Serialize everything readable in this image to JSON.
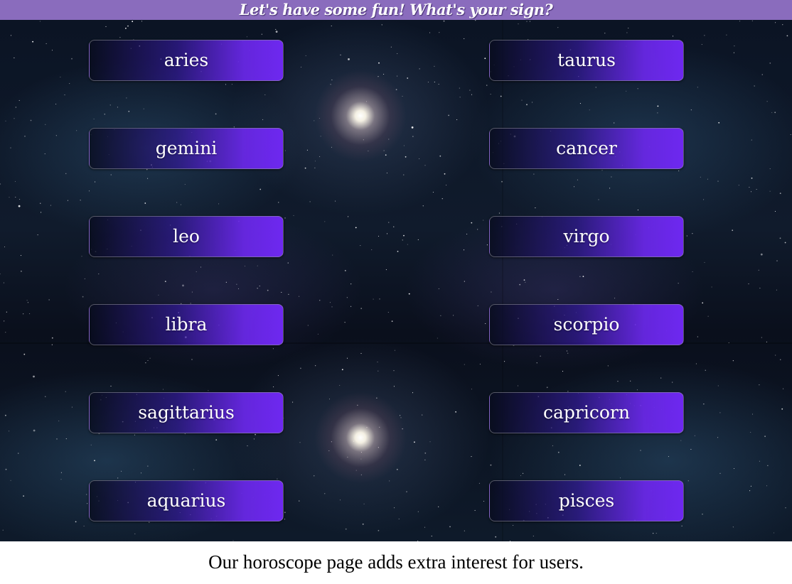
{
  "header": {
    "title": "Let's have some fun! What's your sign?"
  },
  "signs": {
    "left": [
      {
        "label": "aries"
      },
      {
        "label": "gemini"
      },
      {
        "label": "leo"
      },
      {
        "label": "libra"
      },
      {
        "label": "sagittarius"
      },
      {
        "label": "aquarius"
      }
    ],
    "right": [
      {
        "label": "taurus"
      },
      {
        "label": "cancer"
      },
      {
        "label": "virgo"
      },
      {
        "label": "scorpio"
      },
      {
        "label": "capricorn"
      },
      {
        "label": "pisces"
      }
    ]
  },
  "caption": {
    "text": "Our horoscope page adds extra interest for users."
  },
  "colors": {
    "header_bg": "#8a6cbd",
    "button_accent": "#6e28f0"
  }
}
